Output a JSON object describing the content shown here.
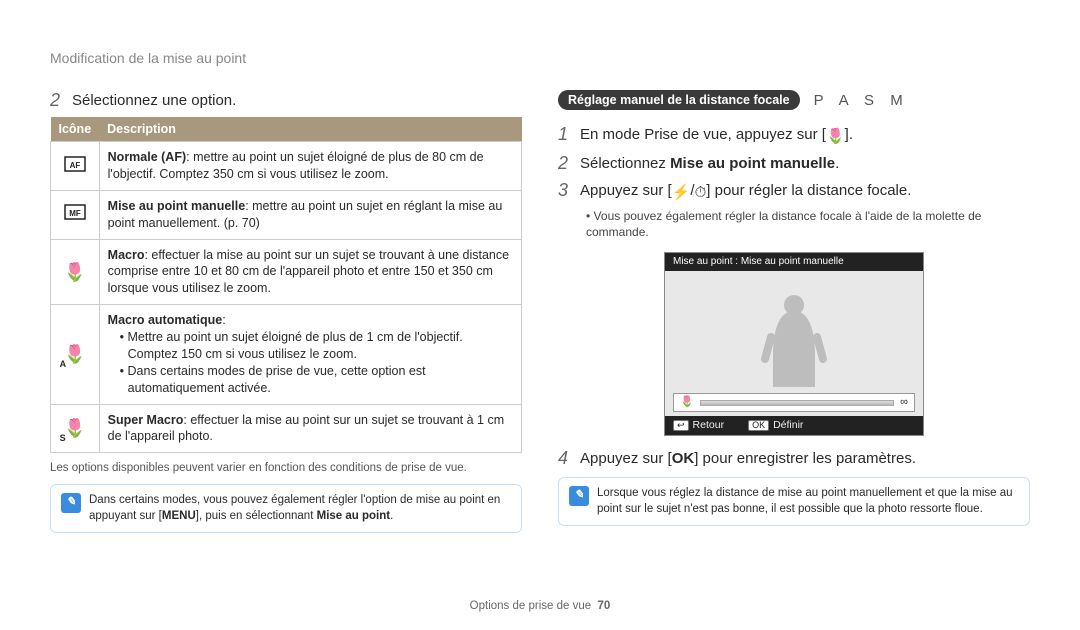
{
  "breadcrumb": "Modification de la mise au point",
  "left": {
    "step2_label": "2",
    "step2_text": "Sélectionnez une option.",
    "th_icon": "Icône",
    "th_desc": "Description",
    "row1_bold": "Normale (AF)",
    "row1_text": ": mettre au point un sujet éloigné de plus de 80 cm de l'objectif. Comptez 350 cm si vous utilisez le zoom.",
    "row2_bold": "Mise au point manuelle",
    "row2_text": ": mettre au point un sujet en réglant la mise au point manuellement. (p. 70)",
    "row3_bold": "Macro",
    "row3_text": ": effectuer la mise au point sur un sujet se trouvant à une distance comprise entre 10 et 80 cm de l'appareil photo et entre 150 et 350 cm lorsque vous utilisez le zoom.",
    "row4_bold": "Macro automatique",
    "row4_text_colon": ":",
    "row4_b1": "Mettre au point un sujet éloigné de plus de 1 cm de l'objectif. Comptez 150 cm si vous utilisez le zoom.",
    "row4_b2": "Dans certains modes de prise de vue, cette option est automatiquement activée.",
    "row5_bold": "Super Macro",
    "row5_text": ": effectuer la mise au point sur un sujet se trouvant à 1 cm de l'appareil photo.",
    "varnote": "Les options disponibles peuvent varier en fonction des conditions de prise de vue.",
    "tip_part1": "Dans certains modes, vous pouvez également régler l'option de mise au point en appuyant sur [",
    "tip_menu": "MENU",
    "tip_part2": "], puis en sélectionnant ",
    "tip_bold": "Mise au point",
    "tip_part3": "."
  },
  "right": {
    "pill": "Réglage manuel de la distance focale",
    "modes": "P A S M",
    "s1n": "1",
    "s1t": "En mode Prise de vue, appuyez sur [",
    "s1t2": "].",
    "s2n": "2",
    "s2t": "Sélectionnez ",
    "s2b": "Mise au point manuelle",
    "s2t2": ".",
    "s3n": "3",
    "s3t": "Appuyez sur [",
    "s3mid": "/",
    "s3t2": "] pour régler la distance focale.",
    "s3sub": "Vous pouvez également régler la distance focale à l'aide de la molette de commande.",
    "preview_title": "Mise au point : Mise au point manuelle",
    "slider_left": "🌷",
    "slider_right": "∞",
    "footer_back_key": "↩",
    "footer_back": "Retour",
    "footer_ok_key": "OK",
    "footer_ok": "Définir",
    "s4n": "4",
    "s4t": "Appuyez sur [",
    "s4ok": "OK",
    "s4t2": "] pour enregistrer les paramètres.",
    "tip": "Lorsque vous réglez la distance de mise au point manuellement et que la mise au point sur le sujet n'est pas bonne, il est possible que la photo ressorte floue."
  },
  "footer": {
    "section": "Options de prise de vue",
    "page": "70"
  }
}
